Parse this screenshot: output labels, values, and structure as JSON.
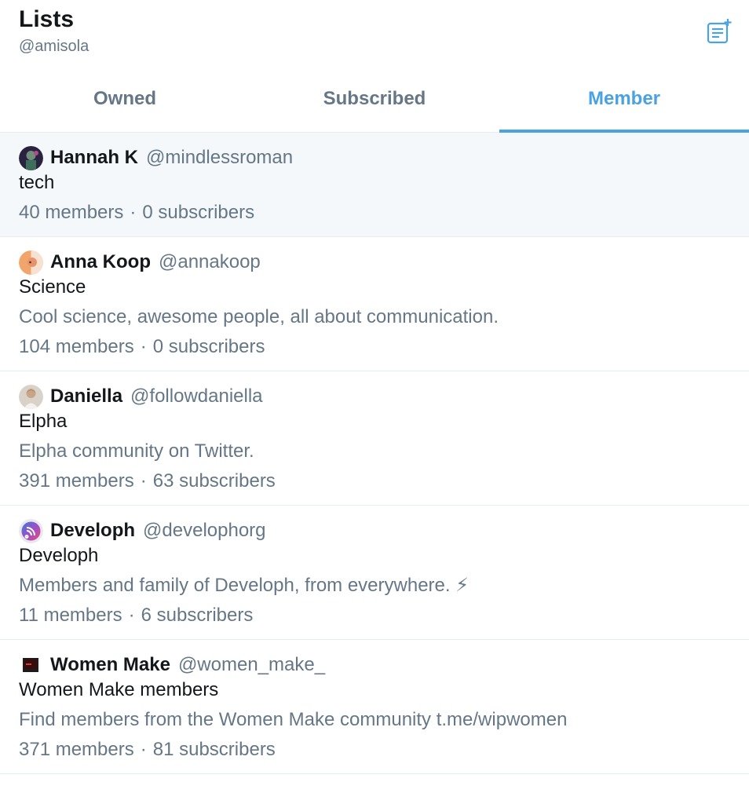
{
  "header": {
    "title": "Lists",
    "handle": "@amisola"
  },
  "tabs": [
    {
      "label": "Owned",
      "active": false
    },
    {
      "label": "Subscribed",
      "active": false
    },
    {
      "label": "Member",
      "active": true
    }
  ],
  "lists": [
    {
      "owner_name": "Hannah K",
      "owner_handle": "@mindlessroman",
      "name": "tech",
      "description": "",
      "members": "40 members",
      "subscribers": "0 subscribers"
    },
    {
      "owner_name": "Anna Koop",
      "owner_handle": "@annakoop",
      "name": "Science",
      "description": "Cool science, awesome people,  all about communication.",
      "members": "104 members",
      "subscribers": "0 subscribers"
    },
    {
      "owner_name": "Daniella",
      "owner_handle": "@followdaniella",
      "name": "Elpha",
      "description": "Elpha community on Twitter.",
      "members": "391 members",
      "subscribers": "63 subscribers"
    },
    {
      "owner_name": "Developh",
      "owner_handle": "@develophorg",
      "name": "Developh",
      "description": "Members and family of Developh, from everywhere. ⚡",
      "members": "11 members",
      "subscribers": "6 subscribers"
    },
    {
      "owner_name": "Women Make",
      "owner_handle": "@women_make_",
      "name": "Women Make members",
      "description": "Find members from the Women Make community t.me/wipwomen",
      "members": "371 members",
      "subscribers": "81 subscribers"
    }
  ],
  "stats_separator": "·",
  "colors": {
    "accent": "#4aa1e4",
    "secondary_text": "#657786",
    "primary_text": "#14171a",
    "hover_bg": "#f5f8fa",
    "border": "#e6ecf0"
  },
  "icons": {
    "new_list": "new-list-icon"
  }
}
